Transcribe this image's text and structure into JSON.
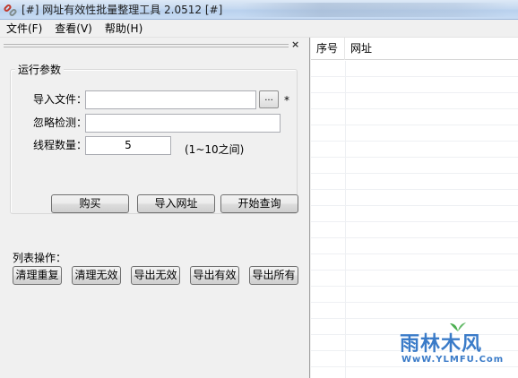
{
  "window": {
    "title": "[#] 网址有效性批量整理工具 2.0512 [#]"
  },
  "menu": {
    "items": [
      "文件(F)",
      "查看(V)",
      "帮助(H)"
    ]
  },
  "panel": {
    "close_glyph": "×"
  },
  "params": {
    "legend": "运行参数",
    "import_label": "导入文件：",
    "import_value": "",
    "browse_label": "...",
    "required_mark": "*",
    "ignore_label": "忽略检测：",
    "ignore_value": "",
    "threads_label": "线程数量：",
    "threads_value": "5",
    "threads_hint": "(1~10之间)"
  },
  "actions": {
    "buy": "购买",
    "import_urls": "导入网址",
    "start_query": "开始查询"
  },
  "list_ops": {
    "label": "列表操作：",
    "clear_dup": "清理重复",
    "clear_invalid": "清理无效",
    "export_invalid": "导出无效",
    "export_valid": "导出有效",
    "export_all": "导出所有"
  },
  "table": {
    "columns": [
      "序号",
      "网址"
    ]
  },
  "watermark": {
    "logo": "雨林木风",
    "url": "WwW.YLMFU.Com"
  },
  "icons": {
    "app": "chain-link-icon",
    "close": "close-icon"
  },
  "colors": {
    "titlebar": "#c6d9f0",
    "window_bg": "#f0f0f0",
    "watermark_blue": "#3a7bc8"
  }
}
